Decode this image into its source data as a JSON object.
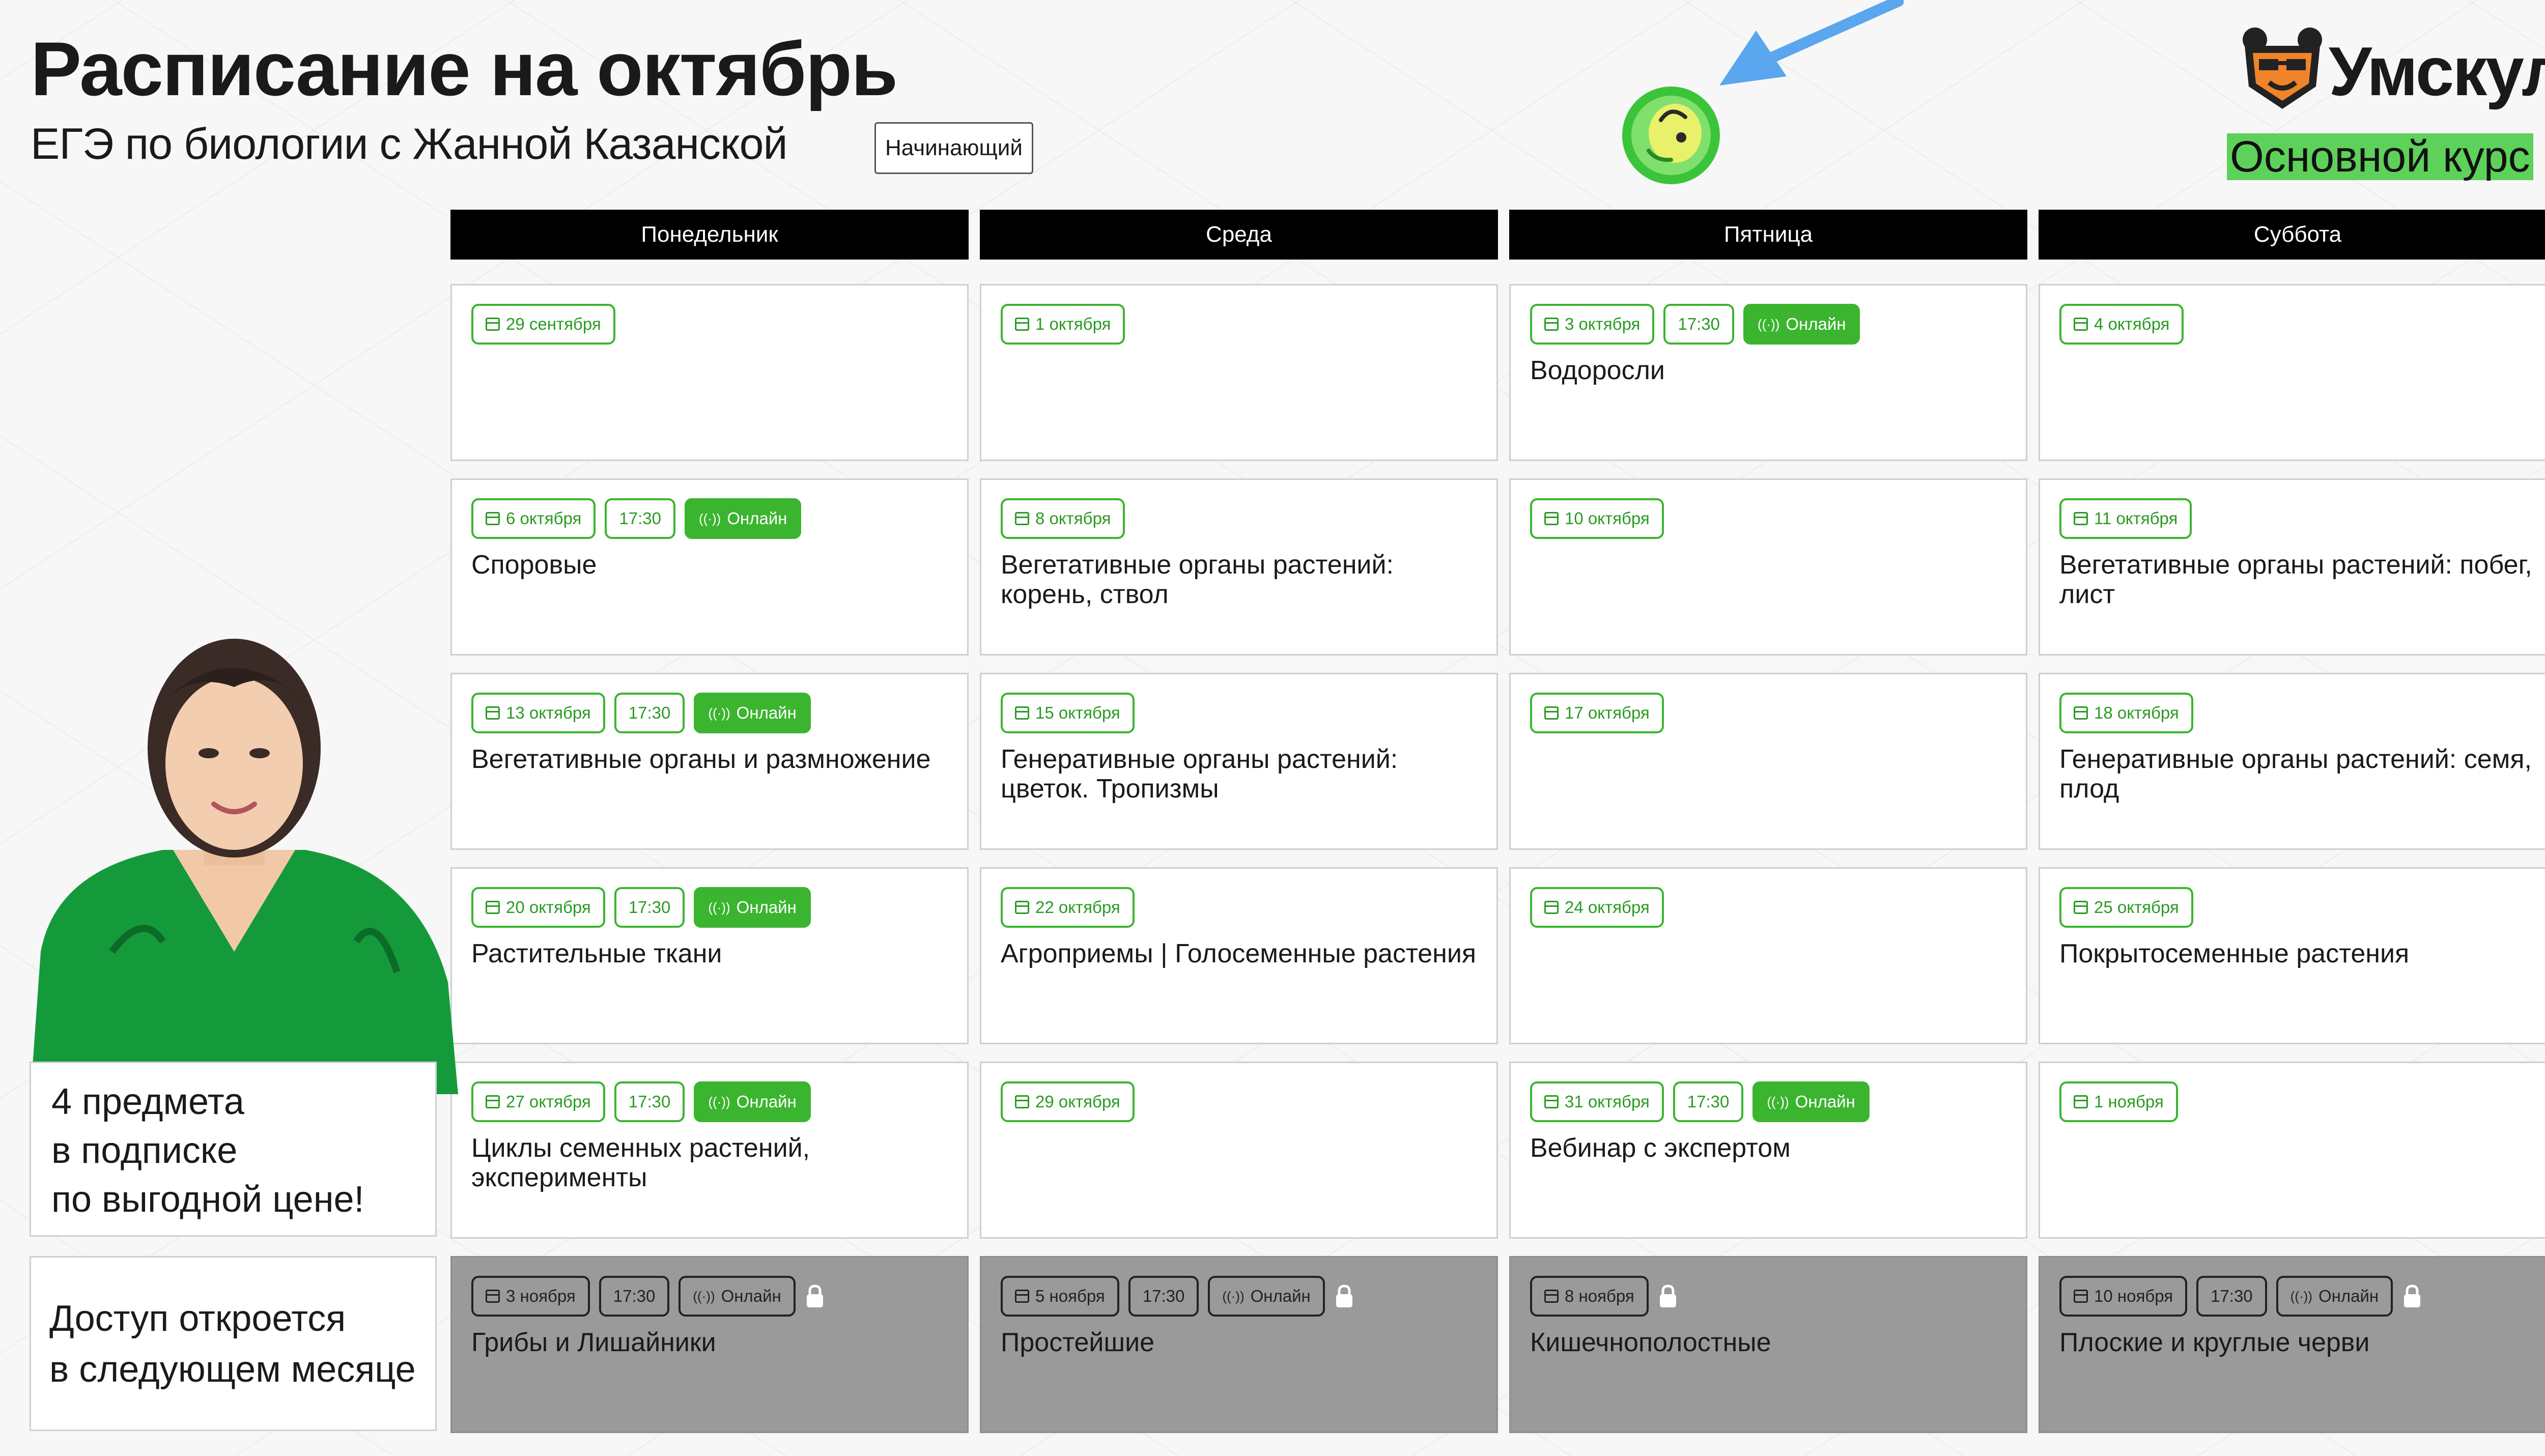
{
  "header": {
    "title": "Расписание на октябрь",
    "subtitle": "ЕГЭ по биологии с Жанной Казанской",
    "level": "Начинающий"
  },
  "brand": {
    "name": "Умскул",
    "course": "Основной курс"
  },
  "colors": {
    "accent": "#3bb52f",
    "course_tag": "#5ed15a",
    "header_bg": "#000000",
    "locked_bg": "#9a9a9a",
    "arrow": "#5aa6ef",
    "logo_orange": "#f0842a"
  },
  "days": [
    "Понедельник",
    "Среда",
    "Пятница",
    "Суббота"
  ],
  "rows": [
    [
      {
        "date": "29 сентября",
        "time": "",
        "online": "",
        "title": ""
      },
      {
        "date": "1 октября",
        "time": "",
        "online": "",
        "title": ""
      },
      {
        "date": "3 октября",
        "time": "17:30",
        "online": "Онлайн",
        "title": "Водоросли"
      },
      {
        "date": "4 октября",
        "time": "",
        "online": "",
        "title": ""
      }
    ],
    [
      {
        "date": "6 октября",
        "time": "17:30",
        "online": "Онлайн",
        "title": "Споровые"
      },
      {
        "date": "8 октября",
        "time": "",
        "online": "",
        "title": "Вегетативные органы растений: корень, ствол"
      },
      {
        "date": "10 октября",
        "time": "",
        "online": "",
        "title": ""
      },
      {
        "date": "11 октября",
        "time": "",
        "online": "",
        "title": "Вегетативные органы растений: побег, лист"
      }
    ],
    [
      {
        "date": "13 октября",
        "time": "17:30",
        "online": "Онлайн",
        "title": "Вегетативные органы и размножение"
      },
      {
        "date": "15 октября",
        "time": "",
        "online": "",
        "title": "Генеративные органы растений: цветок. Тропизмы"
      },
      {
        "date": "17 октября",
        "time": "",
        "online": "",
        "title": ""
      },
      {
        "date": "18 октября",
        "time": "",
        "online": "",
        "title": "Генеративные органы растений: семя, плод"
      }
    ],
    [
      {
        "date": "20 октября",
        "time": "17:30",
        "online": "Онлайн",
        "title": "Растительные ткани"
      },
      {
        "date": "22 октября",
        "time": "",
        "online": "",
        "title": "Агроприемы | Голосеменные растения"
      },
      {
        "date": "24 октября",
        "time": "",
        "online": "",
        "title": ""
      },
      {
        "date": "25 октября",
        "time": "",
        "online": "",
        "title": "Покрытосеменные растения"
      }
    ],
    [
      {
        "date": "27 октября",
        "time": "17:30",
        "online": "Онлайн",
        "title": "Циклы семенных растений, эксперименты"
      },
      {
        "date": "29 октября",
        "time": "",
        "online": "",
        "title": ""
      },
      {
        "date": "31 октября",
        "time": "17:30",
        "online": "Онлайн",
        "title": "Вебинар с экспертом"
      },
      {
        "date": "1 ноября",
        "time": "",
        "online": "",
        "title": ""
      }
    ],
    [
      {
        "date": "3 ноября",
        "time": "17:30",
        "online": "Онлайн",
        "title": "Грибы и Лишайники",
        "locked": true
      },
      {
        "date": "5 ноября",
        "time": "17:30",
        "online": "Онлайн",
        "title": "Простейшие",
        "locked": true
      },
      {
        "date": "8 ноября",
        "time": "",
        "online": "",
        "title": "Кишечнополостные",
        "locked": true
      },
      {
        "date": "10 ноября",
        "time": "17:30",
        "online": "Онлайн",
        "title": "Плоские и круглые черви",
        "locked": true
      }
    ]
  ],
  "promo": {
    "line1": "4 предмета",
    "line2": "в подписке",
    "line3": "по выгодной цене!",
    "access_line1": "Доступ откроется",
    "access_line2": "в следующем месяце"
  },
  "icons": {
    "date": "calendar-icon",
    "online": "broadcast-icon",
    "locked": "lock-icon",
    "logo": "bear-logo-icon",
    "pointer": "arrow-icon",
    "sticker": "sticker-icon"
  }
}
